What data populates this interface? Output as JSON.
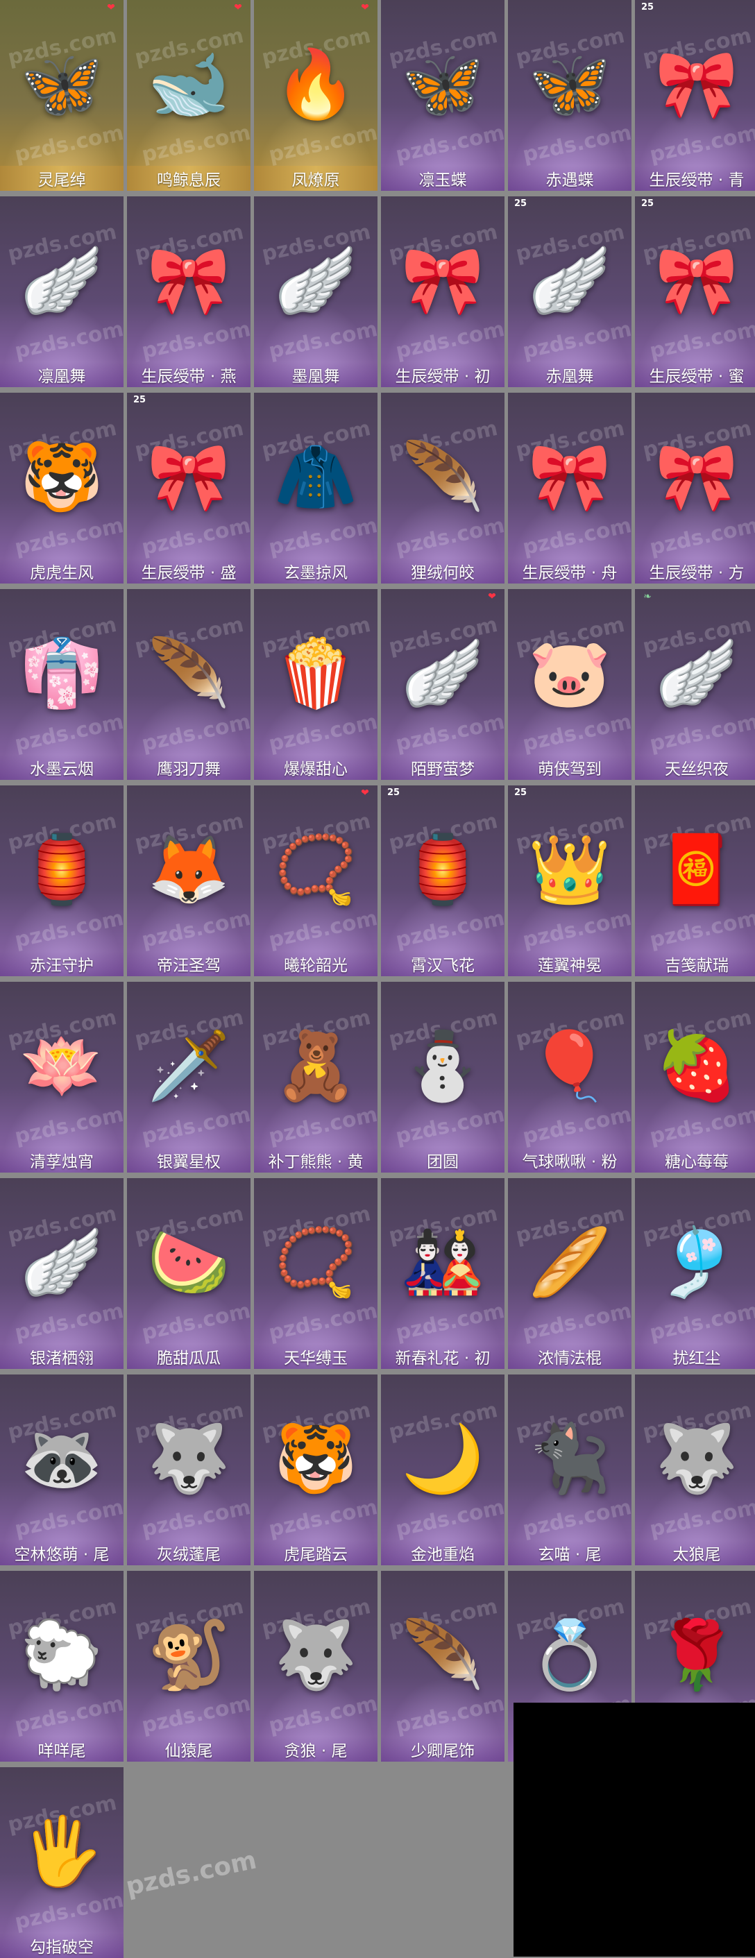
{
  "watermark": "pzds.com",
  "items": [
    {
      "label": "灵尾绰",
      "art": "🦋",
      "badge": "heart",
      "theme": "gold"
    },
    {
      "label": "鸣鲸息辰",
      "art": "🐋",
      "badge": "heart",
      "theme": "gold"
    },
    {
      "label": "凤燎原",
      "art": "🔥",
      "badge": "heart",
      "theme": "gold"
    },
    {
      "label": "凛玉蝶",
      "art": "🦋",
      "badge": "",
      "theme": "purple"
    },
    {
      "label": "赤遇蝶",
      "art": "🦋",
      "badge": "",
      "theme": "purple"
    },
    {
      "label": "生辰绶带 · 青",
      "art": "🎀",
      "badge": "25",
      "theme": "purple"
    },
    {
      "label": "凛凰舞",
      "art": "🪽",
      "badge": "",
      "theme": "purple"
    },
    {
      "label": "生辰绶带 · 燕",
      "art": "🎀",
      "badge": "",
      "theme": "purple"
    },
    {
      "label": "墨凰舞",
      "art": "🪽",
      "badge": "",
      "theme": "purple"
    },
    {
      "label": "生辰绶带 · 初",
      "art": "🎀",
      "badge": "",
      "theme": "purple"
    },
    {
      "label": "赤凰舞",
      "art": "🪽",
      "badge": "25",
      "theme": "purple"
    },
    {
      "label": "生辰绶带 · 蜜",
      "art": "🎀",
      "badge": "25",
      "theme": "purple"
    },
    {
      "label": "虎虎生风",
      "art": "🐯",
      "badge": "",
      "theme": "purple"
    },
    {
      "label": "生辰绶带 · 盛",
      "art": "🎀",
      "badge": "25",
      "theme": "purple"
    },
    {
      "label": "玄墨掠风",
      "art": "🧥",
      "badge": "",
      "theme": "purple"
    },
    {
      "label": "狸绒何皎",
      "art": "🪶",
      "badge": "",
      "theme": "purple"
    },
    {
      "label": "生辰绶带 · 舟",
      "art": "🎀",
      "badge": "",
      "theme": "purple"
    },
    {
      "label": "生辰绶带 · 方",
      "art": "🎀",
      "badge": "",
      "theme": "purple"
    },
    {
      "label": "水墨云烟",
      "art": "👘",
      "badge": "",
      "theme": "purple"
    },
    {
      "label": "鹰羽刀舞",
      "art": "🪶",
      "badge": "",
      "theme": "purple"
    },
    {
      "label": "爆爆甜心",
      "art": "🍿",
      "badge": "",
      "theme": "purple"
    },
    {
      "label": "陌野萤梦",
      "art": "🪽",
      "badge": "heart",
      "theme": "purple"
    },
    {
      "label": "萌侠驾到",
      "art": "🐷",
      "badge": "",
      "theme": "purple"
    },
    {
      "label": "天丝织夜",
      "art": "🪽",
      "badge": "leaf",
      "theme": "purple"
    },
    {
      "label": "赤汪守护",
      "art": "🏮",
      "badge": "",
      "theme": "purple"
    },
    {
      "label": "帝汪圣驾",
      "art": "🦊",
      "badge": "",
      "theme": "purple"
    },
    {
      "label": "曦轮韶光",
      "art": "📿",
      "badge": "heart",
      "theme": "purple"
    },
    {
      "label": "霄汉飞花",
      "art": "🏮",
      "badge": "25",
      "theme": "purple"
    },
    {
      "label": "莲翼神冕",
      "art": "👑",
      "badge": "25",
      "theme": "purple"
    },
    {
      "label": "吉笺献瑞",
      "art": "🧧",
      "badge": "",
      "theme": "purple"
    },
    {
      "label": "清莩烛宵",
      "art": "🪷",
      "badge": "",
      "theme": "purple"
    },
    {
      "label": "银翼星权",
      "art": "🗡️",
      "badge": "",
      "theme": "purple"
    },
    {
      "label": "补丁熊熊 · 黄",
      "art": "🧸",
      "badge": "",
      "theme": "purple"
    },
    {
      "label": "团圆",
      "art": "⛄",
      "badge": "",
      "theme": "purple"
    },
    {
      "label": "气球啾啾 · 粉",
      "art": "🎈",
      "badge": "",
      "theme": "purple"
    },
    {
      "label": "糖心莓莓",
      "art": "🍓",
      "badge": "",
      "theme": "purple"
    },
    {
      "label": "银渚栖翎",
      "art": "🪽",
      "badge": "",
      "theme": "purple"
    },
    {
      "label": "脆甜瓜瓜",
      "art": "🍉",
      "badge": "",
      "theme": "purple"
    },
    {
      "label": "天华缚玉",
      "art": "📿",
      "badge": "",
      "theme": "purple"
    },
    {
      "label": "新春礼花 · 初",
      "art": "🎎",
      "badge": "",
      "theme": "purple"
    },
    {
      "label": "浓情法棍",
      "art": "🥖",
      "badge": "",
      "theme": "purple"
    },
    {
      "label": "扰红尘",
      "art": "🎐",
      "badge": "",
      "theme": "purple"
    },
    {
      "label": "空林悠萌 · 尾",
      "art": "🦝",
      "badge": "",
      "theme": "purple"
    },
    {
      "label": "灰绒蓬尾",
      "art": "🐺",
      "badge": "",
      "theme": "purple"
    },
    {
      "label": "虎尾踏云",
      "art": "🐯",
      "badge": "",
      "theme": "purple"
    },
    {
      "label": "金池重焰",
      "art": "🌙",
      "badge": "",
      "theme": "purple"
    },
    {
      "label": "玄喵 · 尾",
      "art": "🐈‍⬛",
      "badge": "",
      "theme": "purple"
    },
    {
      "label": "太狼尾",
      "art": "🐺",
      "badge": "",
      "theme": "purple"
    },
    {
      "label": "咩咩尾",
      "art": "🐑",
      "badge": "",
      "theme": "purple"
    },
    {
      "label": "仙猿尾",
      "art": "🐒",
      "badge": "",
      "theme": "purple"
    },
    {
      "label": "贪狼 · 尾",
      "art": "🐺",
      "badge": "",
      "theme": "purple"
    },
    {
      "label": "少卿尾饰",
      "art": "🪶",
      "badge": "",
      "theme": "purple"
    },
    {
      "label": "",
      "art": "💍",
      "badge": "",
      "theme": "purple"
    },
    {
      "label": "",
      "art": "🌹",
      "badge": "",
      "theme": "purple"
    },
    {
      "label": "勾指破空",
      "art": "🖐️",
      "badge": "",
      "theme": "purple"
    }
  ]
}
